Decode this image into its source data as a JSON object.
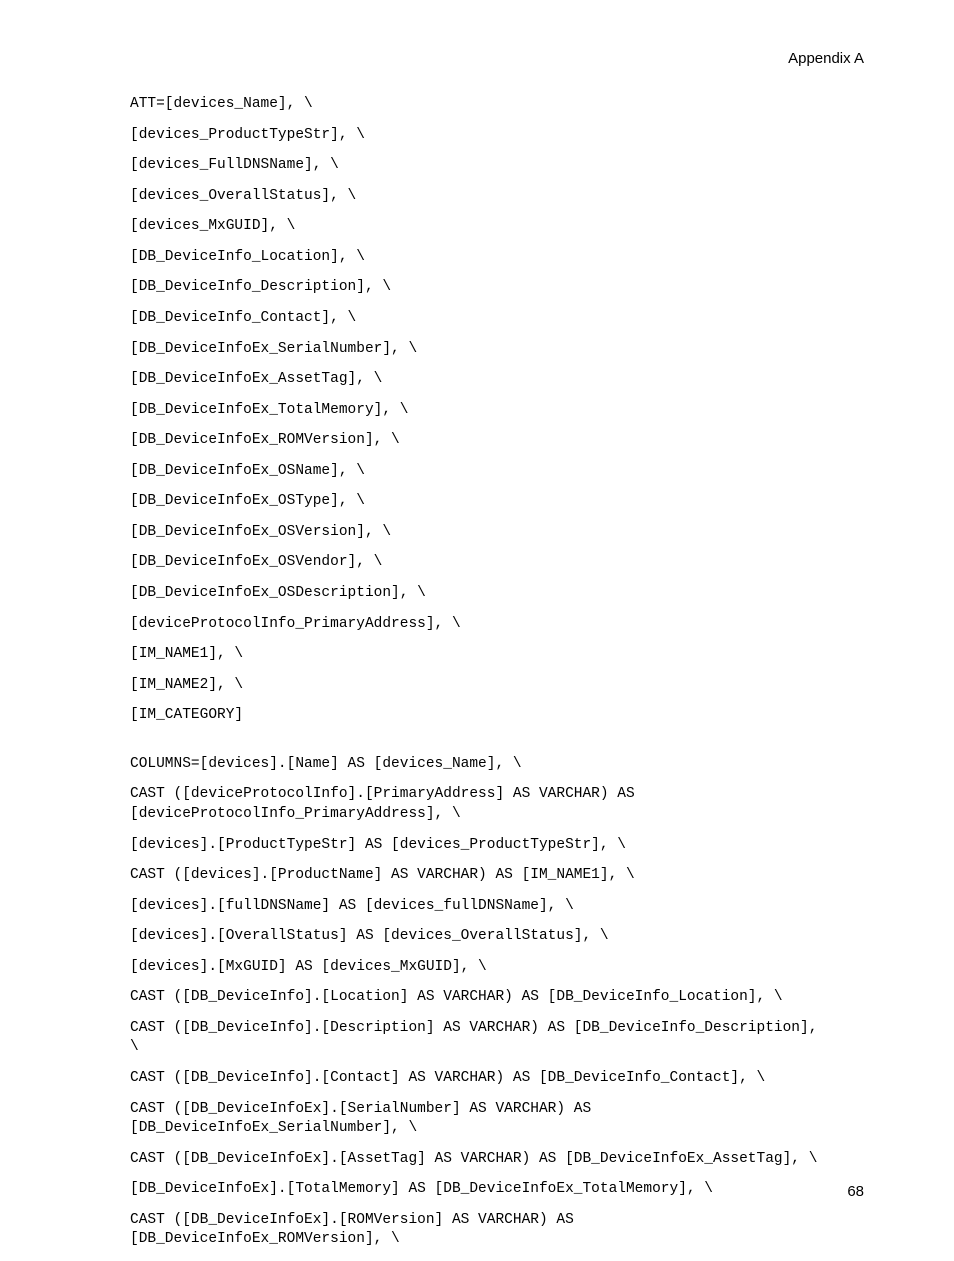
{
  "header": "Appendix A",
  "pageNumber": "68",
  "lines": [
    {
      "t": "ATT=[devices_Name], \\"
    },
    {
      "t": "[devices_ProductTypeStr], \\"
    },
    {
      "t": "[devices_FullDNSName], \\"
    },
    {
      "t": "[devices_OverallStatus], \\"
    },
    {
      "t": "[devices_MxGUID], \\"
    },
    {
      "t": "[DB_DeviceInfo_Location], \\"
    },
    {
      "t": "[DB_DeviceInfo_Description], \\"
    },
    {
      "t": "[DB_DeviceInfo_Contact], \\"
    },
    {
      "t": "[DB_DeviceInfoEx_SerialNumber], \\"
    },
    {
      "t": "[DB_DeviceInfoEx_AssetTag], \\"
    },
    {
      "t": "[DB_DeviceInfoEx_TotalMemory], \\"
    },
    {
      "t": "[DB_DeviceInfoEx_ROMVersion], \\"
    },
    {
      "t": "[DB_DeviceInfoEx_OSName], \\"
    },
    {
      "t": "[DB_DeviceInfoEx_OSType], \\"
    },
    {
      "t": "[DB_DeviceInfoEx_OSVersion], \\"
    },
    {
      "t": "[DB_DeviceInfoEx_OSVendor], \\"
    },
    {
      "t": "[DB_DeviceInfoEx_OSDescription], \\"
    },
    {
      "t": "[deviceProtocolInfo_PrimaryAddress], \\"
    },
    {
      "t": "[IM_NAME1], \\"
    },
    {
      "t": "[IM_NAME2], \\"
    },
    {
      "t": "[IM_CATEGORY]"
    },
    {
      "gap": true
    },
    {
      "t": "COLUMNS=[devices].[Name] AS [devices_Name], \\"
    },
    {
      "t": "CAST ([deviceProtocolInfo].[PrimaryAddress] AS VARCHAR) AS [deviceProtocolInfo_PrimaryAddress], \\"
    },
    {
      "t": "[devices].[ProductTypeStr] AS [devices_ProductTypeStr], \\"
    },
    {
      "t": "CAST ([devices].[ProductName] AS VARCHAR) AS [IM_NAME1], \\"
    },
    {
      "t": "[devices].[fullDNSName] AS [devices_fullDNSName], \\"
    },
    {
      "t": "[devices].[OverallStatus] AS [devices_OverallStatus], \\"
    },
    {
      "t": "[devices].[MxGUID] AS [devices_MxGUID], \\"
    },
    {
      "t": "CAST ([DB_DeviceInfo].[Location] AS VARCHAR) AS [DB_DeviceInfo_Location], \\"
    },
    {
      "t": "CAST ([DB_DeviceInfo].[Description] AS VARCHAR) AS [DB_DeviceInfo_Description], \\"
    },
    {
      "t": "CAST ([DB_DeviceInfo].[Contact] AS VARCHAR) AS [DB_DeviceInfo_Contact], \\"
    },
    {
      "t": "CAST ([DB_DeviceInfoEx].[SerialNumber] AS VARCHAR) AS [DB_DeviceInfoEx_SerialNumber], \\"
    },
    {
      "t": "CAST ([DB_DeviceInfoEx].[AssetTag] AS VARCHAR) AS [DB_DeviceInfoEx_AssetTag], \\"
    },
    {
      "t": "[DB_DeviceInfoEx].[TotalMemory] AS [DB_DeviceInfoEx_TotalMemory], \\"
    },
    {
      "t": "CAST ([DB_DeviceInfoEx].[ROMVersion] AS VARCHAR) AS [DB_DeviceInfoEx_ROMVersion], \\"
    }
  ]
}
